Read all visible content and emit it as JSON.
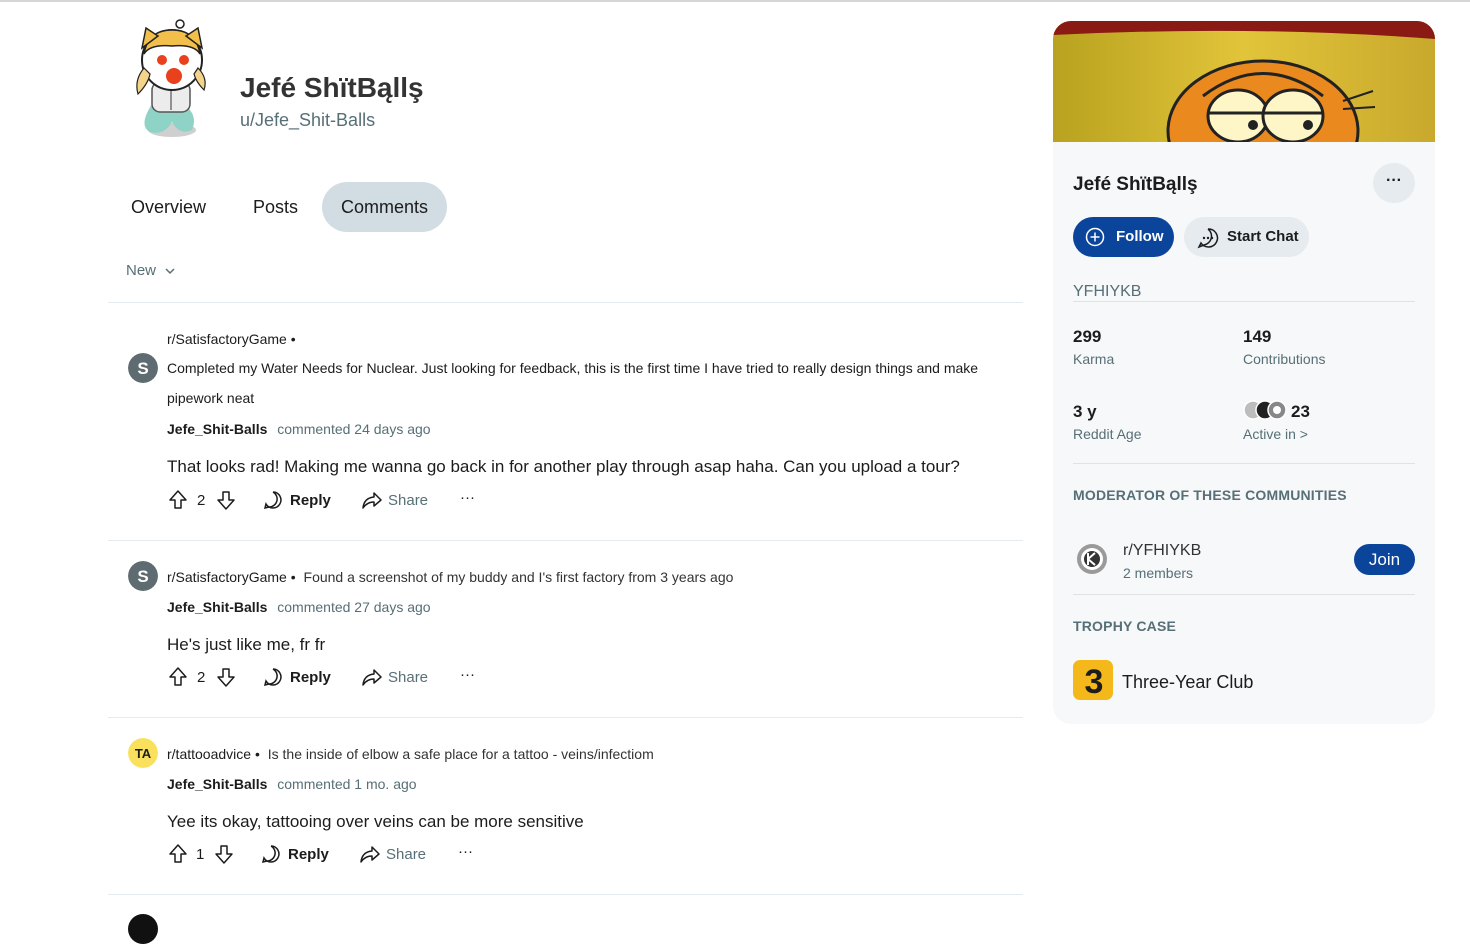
{
  "profile": {
    "display_name": "Jefé ShïtBąllş",
    "username": "u/Jefe_Shit-Balls"
  },
  "tabs": [
    {
      "label": "Overview",
      "active": false
    },
    {
      "label": "Posts",
      "active": false
    },
    {
      "label": "Comments",
      "active": true
    }
  ],
  "sort": {
    "label": "New"
  },
  "comments": [
    {
      "subreddit": "r/SatisfactoryGame",
      "sub_icon_letter": "S",
      "post_title": "Completed my Water Needs for Nuclear. Just looking for feedback, this is the first time I have tried to really design things and make pipework neat",
      "author": "Jefe_Shit-Balls",
      "when": "commented 24 days ago",
      "body": "That looks rad! Making me wanna go back in for another play through asap haha. Can you upload a tour?",
      "votes": "2"
    },
    {
      "subreddit": "r/SatisfactoryGame",
      "sub_icon_letter": "S",
      "post_title": "Found a screenshot of my buddy and I's first factory from 3 years ago",
      "author": "Jefe_Shit-Balls",
      "when": "commented 27 days ago",
      "body": "He's just like me, fr fr",
      "votes": "2"
    },
    {
      "subreddit": "r/tattooadvice",
      "sub_icon_letter": "TA",
      "post_title": "Is the inside of elbow a safe place for a tattoo - veins/infectiom",
      "author": "Jefe_Shit-Balls",
      "when": "commented 1 mo. ago",
      "body": "Yee its okay, tattooing over veins can be more sensitive",
      "votes": "1"
    }
  ],
  "actions": {
    "reply": "Reply",
    "share": "Share",
    "more": "···",
    "separator": "•"
  },
  "sidebar": {
    "name": "Jefé ShïtBąllş",
    "follow": "Follow",
    "start_chat": "Start Chat",
    "more": "···",
    "tagline": "YFHIYKB",
    "stats": [
      {
        "value": "299",
        "label": "Karma"
      },
      {
        "value": "149",
        "label": "Contributions"
      },
      {
        "value": "3 y",
        "label": "Reddit Age"
      },
      {
        "value": "23",
        "label": "Active in >"
      }
    ],
    "moderator_heading": "MODERATOR OF THESE COMMUNITIES",
    "community": {
      "name": "r/YFHIYKB",
      "members": "2 members",
      "join": "Join"
    },
    "trophy_heading": "TROPHY CASE",
    "trophy": {
      "name": "Three-Year Club",
      "badge_text": "3"
    }
  },
  "colors": {
    "accent": "#0a449b",
    "tab_active_bg": "#d2dde3",
    "muted_text": "#576f76",
    "sidebar_bg": "#f6f8f9",
    "tattoo_icon": "#f9e15e",
    "trophy_badge": "#f5b81b"
  }
}
